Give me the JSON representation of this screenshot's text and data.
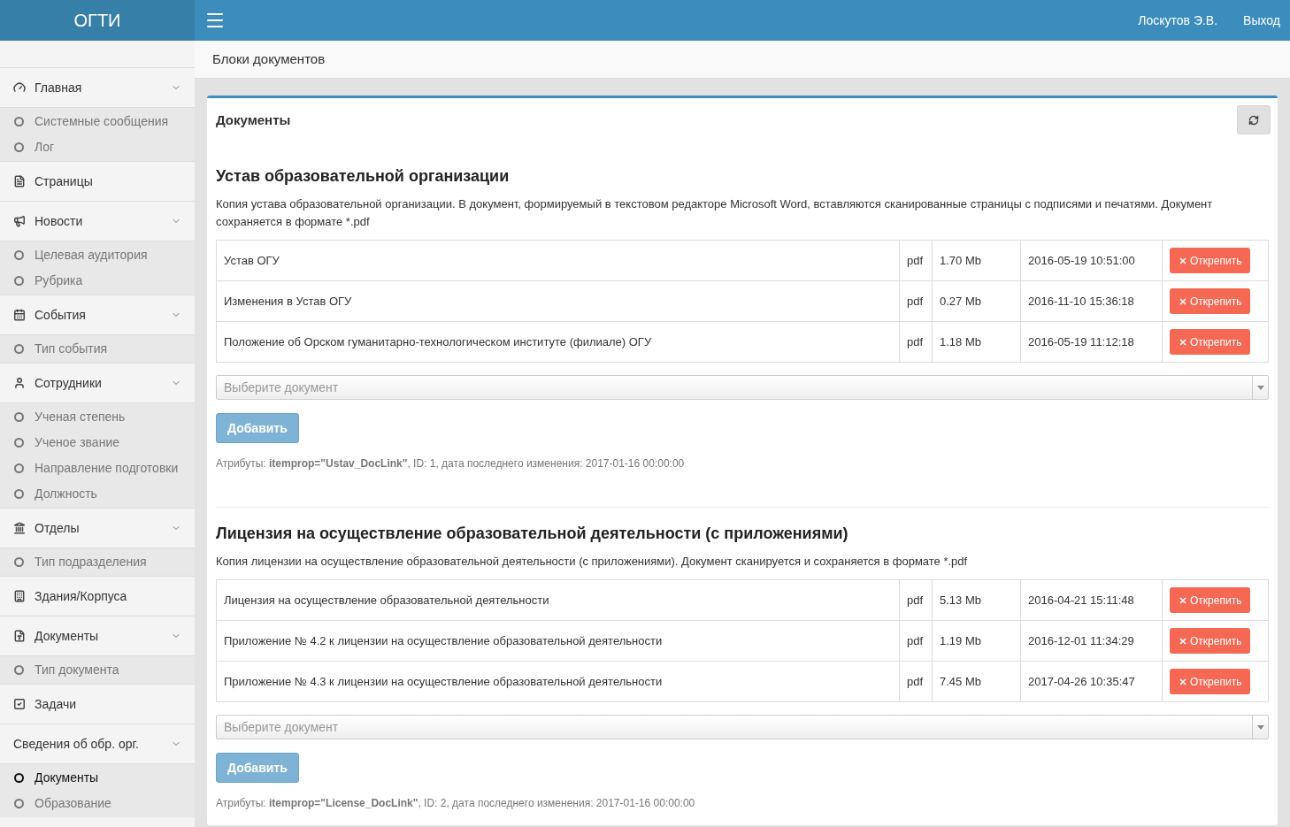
{
  "brand": "ОГТИ",
  "user": "Лоскутов Э.В.",
  "logout": "Выход",
  "sidebar": {
    "groups": [
      {
        "label": "Главная",
        "children": [
          {
            "label": "Системные сообщения",
            "selected": false
          },
          {
            "label": "Лог",
            "selected": false
          }
        ]
      },
      {
        "label": "Страницы"
      },
      {
        "label": "Новости",
        "children": [
          {
            "label": "Целевая аудитория",
            "selected": false
          },
          {
            "label": "Рубрика",
            "selected": false
          }
        ]
      },
      {
        "label": "События",
        "children": [
          {
            "label": "Тип события",
            "selected": false
          }
        ]
      },
      {
        "label": "Сотрудники",
        "children": [
          {
            "label": "Ученая степень",
            "selected": false
          },
          {
            "label": "Ученое звание",
            "selected": false
          },
          {
            "label": "Направление подготовки",
            "selected": false
          },
          {
            "label": "Должность",
            "selected": false
          }
        ]
      },
      {
        "label": "Отделы",
        "children": [
          {
            "label": "Тип подразделения",
            "selected": false
          }
        ]
      },
      {
        "label": "Здания/Корпуса"
      },
      {
        "label": "Документы",
        "children": [
          {
            "label": "Тип документа",
            "selected": false
          }
        ]
      },
      {
        "label": "Задачи"
      },
      {
        "label": "Сведения об обр. орг.",
        "children": [
          {
            "label": "Документы",
            "selected": true
          },
          {
            "label": "Образование",
            "selected": false
          }
        ]
      }
    ]
  },
  "page_title": "Блоки документов",
  "box_title": "Документы",
  "sections": [
    {
      "title": "Устав образовательной организации",
      "description": "Копия устава образовательной организации. В документ, формируемый в текстовом редакторе Microsoft Word, вставляются сканированные страницы с подписями и печатями. Документ сохраняется в формате *.pdf",
      "rows": [
        {
          "name": "Устав ОГУ",
          "type": "pdf",
          "size": "1.70 Mb",
          "date": "2016-05-19 10:51:00",
          "action": "Открепить"
        },
        {
          "name": "Изменения в Устав ОГУ",
          "type": "pdf",
          "size": "0.27 Mb",
          "date": "2016-11-10 15:36:18",
          "action": "Открепить"
        },
        {
          "name": "Положение об Орском гуманитарно-технологическом институте (филиале) ОГУ",
          "type": "pdf",
          "size": "1.18 Mb",
          "date": "2016-05-19 11:12:18",
          "action": "Открепить"
        }
      ],
      "select_placeholder": "Выберите документ",
      "add_button": "Добавить",
      "attributes": "Атрибуты: **itemprop=\"Ustav_DocLink\"**, ID: 1, дата последнего изменения: 2017-01-16 00:00:00"
    },
    {
      "title": "Лицензия на осуществление образовательной деятельности (с приложениями)",
      "description": "Копия лицензии на осуществление образовательной деятельности (с приложениями). Документ сканируется и сохраняется в формате *.pdf",
      "rows": [
        {
          "name": "Лицензия на осуществление образовательной деятельности",
          "type": "pdf",
          "size": "5.13 Mb",
          "date": "2016-04-21 15:11:48",
          "action": "Открепить"
        },
        {
          "name": "Приложение № 4.2 к лицензии на осуществление образовательной деятельности",
          "type": "pdf",
          "size": "1.19 Mb",
          "date": "2016-12-01 11:34:29",
          "action": "Открепить"
        },
        {
          "name": "Приложение № 4.3 к лицензии на осуществление образовательной деятельности",
          "type": "pdf",
          "size": "7.45 Mb",
          "date": "2017-04-26 10:35:47",
          "action": "Открепить"
        }
      ],
      "select_placeholder": "Выберите документ",
      "add_button": "Добавить",
      "attributes": "Атрибуты: **itemprop=\"License_DocLink\"**, ID: 2, дата последнего изменения: 2017-01-16 00:00:00"
    }
  ]
}
